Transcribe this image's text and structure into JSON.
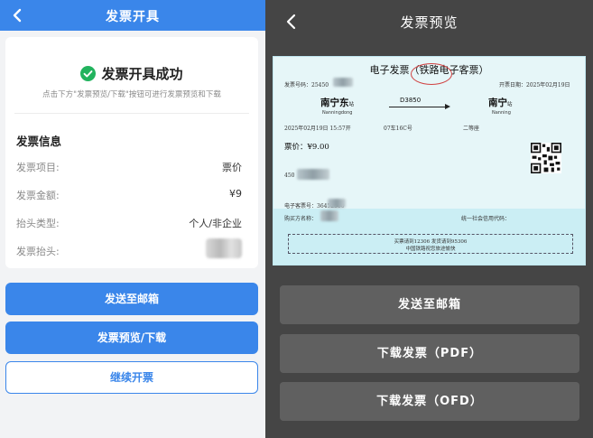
{
  "left": {
    "header": {
      "title": "发票开具"
    },
    "success": {
      "title": "发票开具成功",
      "hint": "点击下方\"发票预览/下载\"按钮可进行发票预览和下载"
    },
    "info": {
      "section_title": "发票信息",
      "rows": [
        {
          "label": "发票项目:",
          "value": "票价"
        },
        {
          "label": "发票金额:",
          "value": "¥9"
        },
        {
          "label": "抬头类型:",
          "value": "个人/非企业"
        },
        {
          "label": "发票抬头:",
          "value": ""
        }
      ]
    },
    "buttons": {
      "send_email": "发送至邮箱",
      "preview_download": "发票预览/下载",
      "continue": "继续开票"
    },
    "colors": {
      "accent": "#3a86ea"
    }
  },
  "right": {
    "header": {
      "title": "发票预览"
    },
    "invoice": {
      "title": "电子发票（铁路电子客票）",
      "invoice_no_label": "发票号码：25450",
      "issue_date": "开票日期：2025年02月19日",
      "from_station": "南宁东",
      "from_pinyin": "Nanningdong",
      "to_station": "南宁",
      "to_pinyin": "Nanning",
      "station_suffix": "站",
      "train_no": "D3850",
      "depart": "2025年02月19日  15:57开",
      "seat": "07车16C号",
      "seat_class": "二等座",
      "price": "票价：¥9.00",
      "id_prefix": "450",
      "ticket_no": "电子客票号：36452560",
      "buyer": "购买方名称：",
      "credit_code": "统一社会信用代码：",
      "notice_1": "买票请到12306  发货请到95306",
      "notice_2": "中国铁路祝您旅途愉快"
    },
    "buttons": {
      "send_email": "发送至邮箱",
      "download_pdf": "下载发票（PDF）",
      "download_ofd": "下载发票（OFD）"
    }
  }
}
